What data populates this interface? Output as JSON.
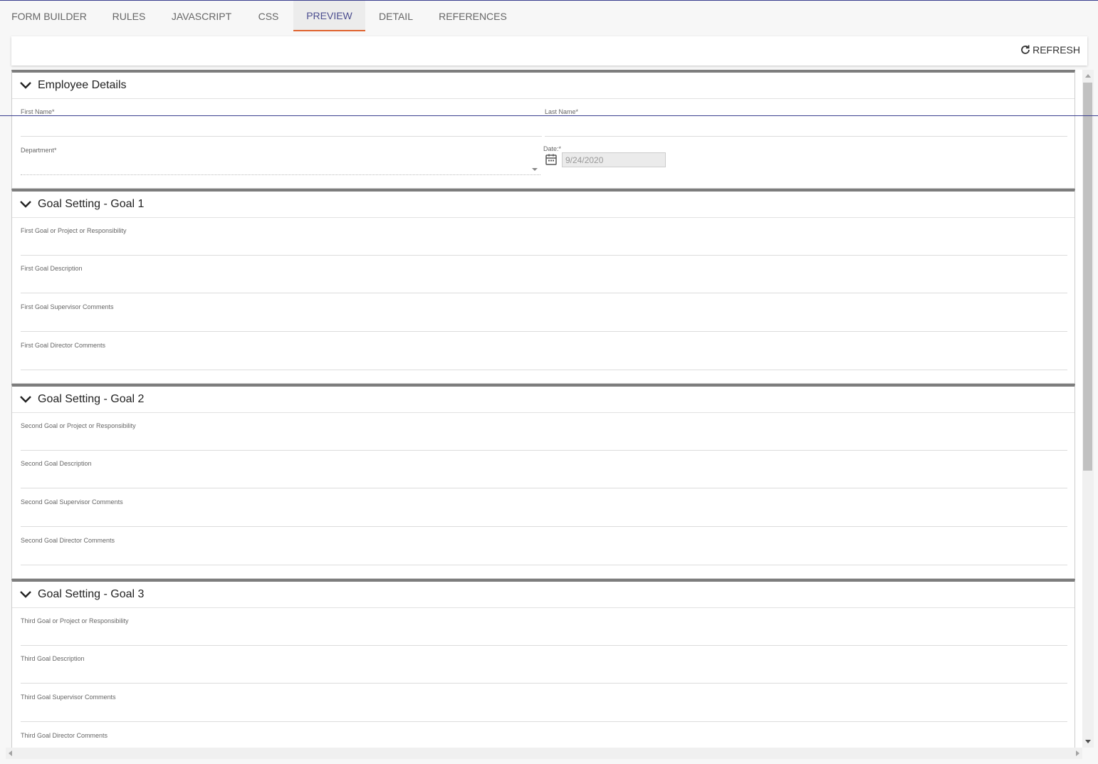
{
  "tabs": [
    {
      "label": "FORM BUILDER"
    },
    {
      "label": "RULES"
    },
    {
      "label": "JAVASCRIPT"
    },
    {
      "label": "CSS"
    },
    {
      "label": "PREVIEW",
      "active": true
    },
    {
      "label": "DETAIL"
    },
    {
      "label": "REFERENCES"
    }
  ],
  "toolbar": {
    "refresh_label": "REFRESH"
  },
  "sections": [
    {
      "title": "Employee Details",
      "fields": {
        "first_name": "First Name*",
        "last_name": "Last Name*",
        "department": "Department*",
        "date_label": "Date:*",
        "date_value": "9/24/2020"
      }
    },
    {
      "title": "Goal Setting - Goal 1",
      "fields": [
        "First Goal or Project or Responsibility",
        "First Goal Description",
        "First Goal Supervisor Comments",
        "First Goal Director Comments"
      ]
    },
    {
      "title": "Goal Setting - Goal 2",
      "fields": [
        "Second Goal or Project or Responsibility",
        "Second Goal Description",
        "Second Goal Supervisor Comments",
        "Second Goal Director Comments"
      ]
    },
    {
      "title": "Goal Setting - Goal 3",
      "fields": [
        "Third Goal or Project or Responsibility",
        "Third Goal Description",
        "Third Goal Supervisor Comments",
        "Third Goal Director Comments"
      ]
    }
  ],
  "colors": {
    "accent": "#e0632f",
    "active_tab_text": "#4b4d8f"
  }
}
